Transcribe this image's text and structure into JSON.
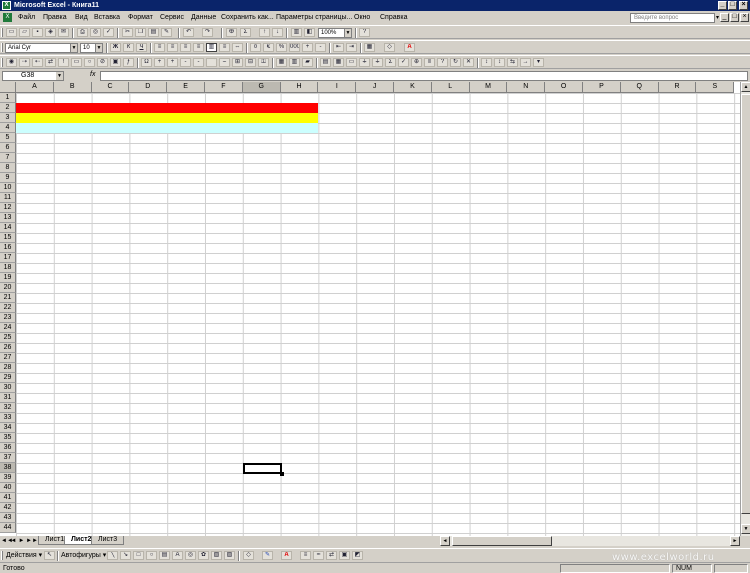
{
  "window": {
    "title": "Microsoft Excel - Книга11",
    "app_icon": "excel-icon",
    "controls": [
      "_",
      "□",
      "×"
    ]
  },
  "menu": {
    "items": [
      "Файл",
      "Правка",
      "Вид",
      "Вставка",
      "Формат",
      "Сервис",
      "Данные",
      "Сохранить как...",
      "Параметры страницы...",
      "Окно",
      "Справка"
    ],
    "help_placeholder": "Введите вопрос"
  },
  "toolbar1": {
    "zoom": "100%"
  },
  "toolbar2": {
    "font_name": "Arial Cyr",
    "font_size": "10",
    "bold": "Ж",
    "italic": "К",
    "underline": "Ч",
    "percent": "%",
    "thousands": "000"
  },
  "formula_bar": {
    "name_box": "G38",
    "fx": "fx",
    "value": ""
  },
  "columns": [
    "A",
    "B",
    "C",
    "D",
    "E",
    "F",
    "G",
    "H",
    "I",
    "J",
    "K",
    "L",
    "M",
    "N",
    "O",
    "P",
    "Q",
    "R",
    "S"
  ],
  "rows": [
    "1",
    "2",
    "3",
    "4",
    "5",
    "6",
    "7",
    "8",
    "9",
    "10",
    "11",
    "12",
    "13",
    "14",
    "15",
    "16",
    "17",
    "18",
    "19",
    "20",
    "21",
    "22",
    "23",
    "24",
    "25",
    "26",
    "27",
    "28",
    "29",
    "30",
    "31",
    "32",
    "33",
    "34",
    "35",
    "36",
    "37",
    "38",
    "39",
    "40",
    "41",
    "42",
    "43",
    "44"
  ],
  "active_cell": {
    "column": "G",
    "row": "38"
  },
  "fills": [
    {
      "row": "2",
      "from_col": "A",
      "to_col": "H",
      "color": "#ff0000"
    },
    {
      "row": "3",
      "from_col": "A",
      "to_col": "H",
      "color": "#ffff00"
    },
    {
      "row": "4",
      "from_col": "A",
      "to_col": "H",
      "color": "#ccffff"
    }
  ],
  "sheets": {
    "nav": [
      "◄◄",
      "◄",
      "►",
      "►►"
    ],
    "tabs": [
      "Лист1",
      "Лист2",
      "Лист3"
    ],
    "active": "Лист2"
  },
  "drawing": {
    "actions": "Действия",
    "autoshapes": "Автофигуры"
  },
  "status": {
    "ready": "Готово",
    "num": "NUM"
  },
  "watermark": "www.excelworld.ru",
  "colors": {
    "title_bar": "#0a246a",
    "chrome": "#d4d0c8",
    "fill_red": "#ff0000",
    "fill_yellow": "#ffff00",
    "fill_lightcyan": "#ccffff"
  }
}
